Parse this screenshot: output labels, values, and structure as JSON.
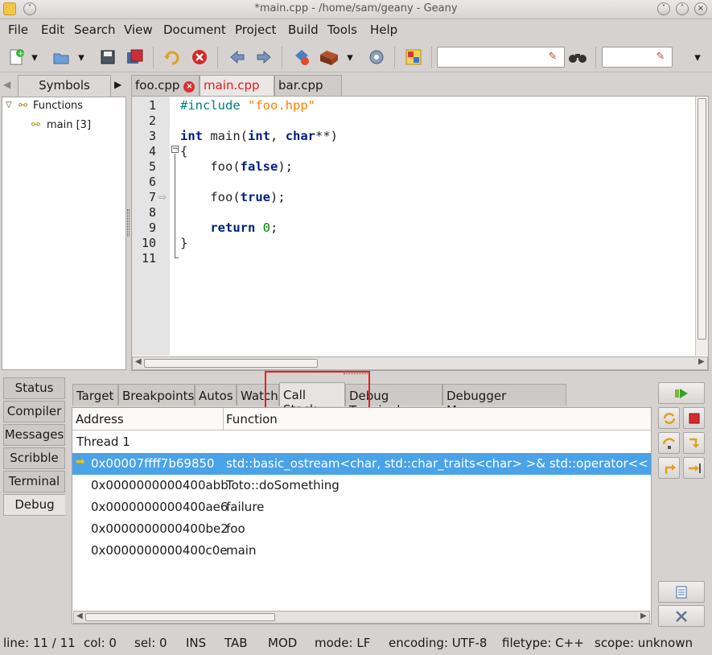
{
  "window": {
    "title": "*main.cpp - /home/sam/geany - Geany"
  },
  "menu": [
    "File",
    "Edit",
    "Search",
    "View",
    "Document",
    "Project",
    "Build",
    "Tools",
    "Help"
  ],
  "sidebar": {
    "tab": "Symbols",
    "tree": {
      "root": "Functions",
      "child": "main [3]"
    }
  },
  "editor": {
    "tabs": [
      {
        "label": "foo.cpp",
        "active": false
      },
      {
        "label": "main.cpp",
        "active": true
      },
      {
        "label": "bar.cpp",
        "active": false
      }
    ],
    "line_numbers": [
      "1",
      "2",
      "3",
      "4",
      "5",
      "6",
      "7",
      "8",
      "9",
      "10",
      "11"
    ],
    "lines": [
      "#include \"foo.hpp\"",
      "",
      "int main(int, char**)",
      "{",
      "    foo(false);",
      "",
      "    foo(true);",
      "",
      "    return 0;",
      "}",
      ""
    ]
  },
  "bottom": {
    "side_tabs": [
      "Status",
      "Compiler",
      "Messages",
      "Scribble",
      "Terminal",
      "Debug"
    ],
    "debug_tabs": [
      "Target",
      "Breakpoints",
      "Autos",
      "Watch",
      "Call Stack",
      "Debug Terminal",
      "Debugger Messages"
    ],
    "columns": {
      "address": "Address",
      "function": "Function"
    },
    "thread": "Thread 1",
    "frames": [
      {
        "address": "0x00007ffff7b69850",
        "function": "std::basic_ostream<char, std::char_traits<char> >& std::operator<< <char, s"
      },
      {
        "address": "0x0000000000400abb",
        "function": "Toto::doSomething"
      },
      {
        "address": "0x0000000000400ae6",
        "function": "failure"
      },
      {
        "address": "0x0000000000400be2",
        "function": "foo"
      },
      {
        "address": "0x0000000000400c0e",
        "function": "main"
      }
    ]
  },
  "status": {
    "line": "line: 11 / 11",
    "col": "col: 0",
    "sel": "sel: 0",
    "ins": "INS",
    "tab": "TAB",
    "mod": "MOD",
    "mode": "mode: LF",
    "encoding": "encoding: UTF-8",
    "filetype": "filetype: C++",
    "scope": "scope: unknown"
  },
  "colors": {
    "selection": "#4aa3e8",
    "active_tab_text": "#e8191b",
    "highlight_box": "#e62020"
  }
}
